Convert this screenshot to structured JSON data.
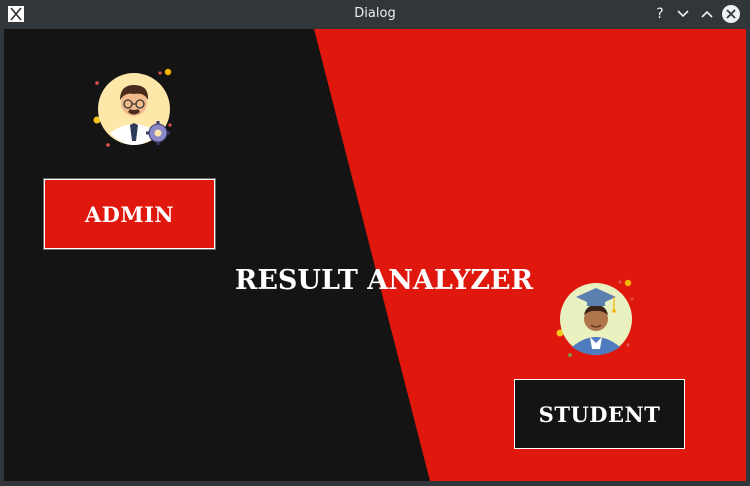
{
  "window": {
    "title": "Dialog",
    "buttons": {
      "help": "?",
      "minimize": "⌄",
      "maximize": "⌃",
      "close": "✕"
    }
  },
  "main": {
    "heading": "RESULT ANALYZER",
    "admin_label": "ADMIN",
    "student_label": "STUDENT"
  },
  "colors": {
    "accent_red": "#e0170d",
    "dark": "#141414",
    "titlebar": "#31363b"
  },
  "icons": {
    "admin": "admin-avatar-icon",
    "student": "student-graduate-icon"
  }
}
